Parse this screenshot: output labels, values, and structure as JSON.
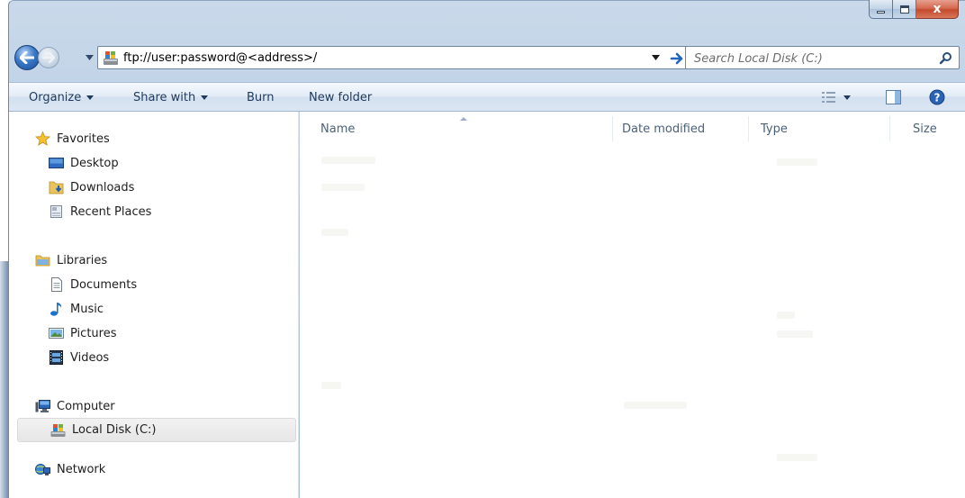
{
  "window": {
    "caption": {
      "minimize": "–",
      "maximize": "□",
      "close": "x"
    }
  },
  "navigation": {
    "address_value": "ftp://user:password@<address>/",
    "search_placeholder": "Search Local Disk (C:)"
  },
  "command_bar": {
    "organize": "Organize",
    "share_with": "Share with",
    "burn": "Burn",
    "new_folder": "New folder"
  },
  "nav_pane": {
    "favorites": {
      "label": "Favorites",
      "icon": "star-icon",
      "items": [
        {
          "label": "Desktop",
          "icon": "desktop-icon"
        },
        {
          "label": "Downloads",
          "icon": "downloads-folder-icon"
        },
        {
          "label": "Recent Places",
          "icon": "recent-places-icon"
        }
      ]
    },
    "libraries": {
      "label": "Libraries",
      "icon": "libraries-icon",
      "items": [
        {
          "label": "Documents",
          "icon": "document-icon"
        },
        {
          "label": "Music",
          "icon": "music-note-icon"
        },
        {
          "label": "Pictures",
          "icon": "pictures-icon"
        },
        {
          "label": "Videos",
          "icon": "videos-icon"
        }
      ]
    },
    "computer": {
      "label": "Computer",
      "icon": "computer-icon",
      "items": [
        {
          "label": "Local Disk (C:)",
          "icon": "local-disk-icon",
          "selected": true
        }
      ]
    },
    "network": {
      "label": "Network",
      "icon": "network-icon"
    }
  },
  "file_list": {
    "columns": [
      "Name",
      "Date modified",
      "Type",
      "Size"
    ],
    "sorted_by": "Name"
  },
  "colors": {
    "accent": "#3a78c8",
    "command_text": "#1e395b",
    "header_text": "#4c607a",
    "close_button": "#c44a2c"
  }
}
